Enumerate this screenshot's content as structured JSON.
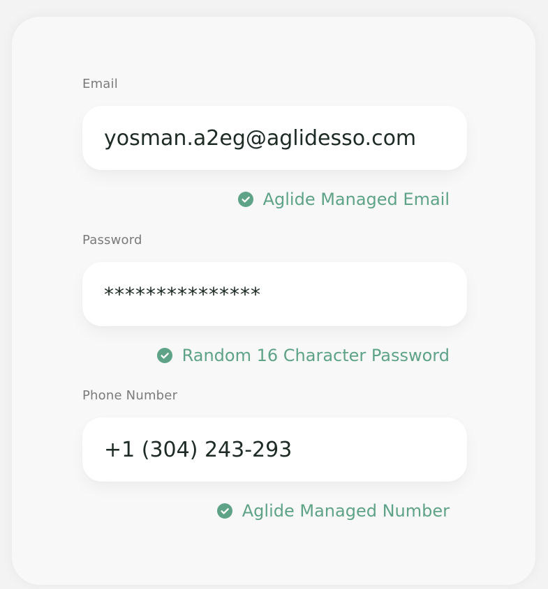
{
  "email": {
    "label": "Email",
    "value": "yosman.a2eg@aglidesso.com",
    "note": "Aglide Managed Email"
  },
  "password": {
    "label": "Password",
    "value": "***************",
    "note": "Random 16 Character Password"
  },
  "phone": {
    "label": "Phone Number",
    "value": "+1 (304) 243-293",
    "note": "Aglide Managed Number"
  },
  "colors": {
    "accent": "#5ea387",
    "text": "#1d2b24",
    "label": "#7a7a7a",
    "field_bg": "#ffffff",
    "card_bg": "#f8f8f8"
  },
  "icons": {
    "note_icon": "check-circle-icon"
  }
}
